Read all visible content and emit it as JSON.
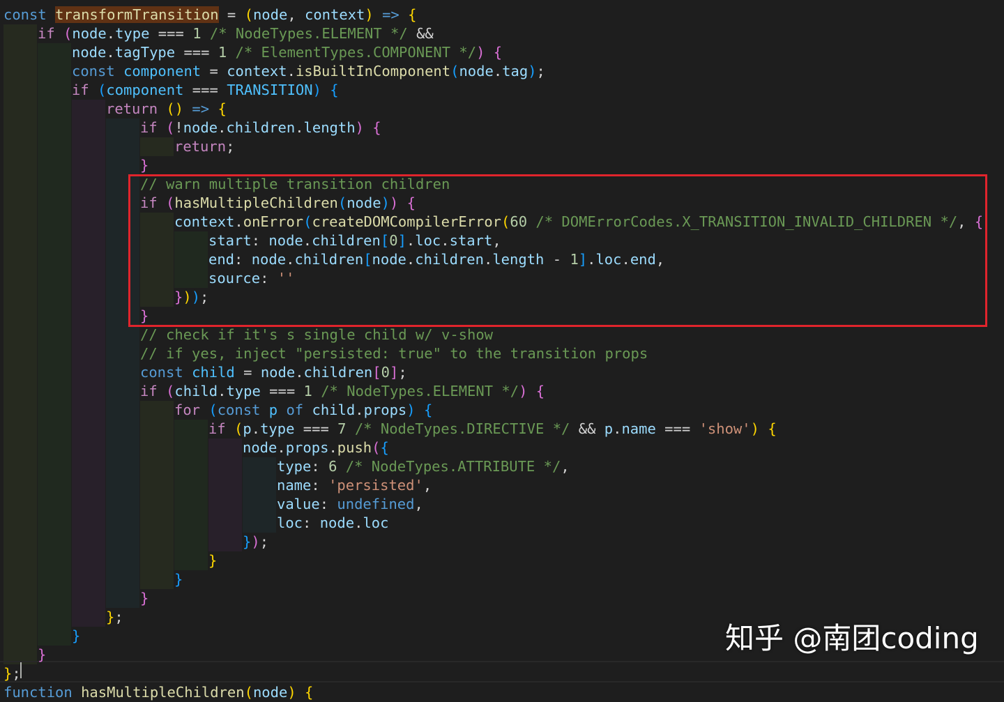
{
  "code_lines": [
    [
      [
        "kw",
        "const "
      ],
      [
        "fnhl",
        "transformTransition"
      ],
      [
        "txt",
        " = "
      ],
      [
        "by",
        "("
      ],
      [
        "var",
        "node"
      ],
      [
        "txt",
        ", "
      ],
      [
        "var",
        "context"
      ],
      [
        "by",
        ")"
      ],
      [
        "kw",
        " => "
      ],
      [
        "by",
        "{"
      ]
    ],
    [
      [
        "kwc",
        "if "
      ],
      [
        "bp",
        "("
      ],
      [
        "var",
        "node"
      ],
      [
        "txt",
        "."
      ],
      [
        "var",
        "type"
      ],
      [
        "txt",
        " === "
      ],
      [
        "num",
        "1"
      ],
      [
        "cmt",
        " /* NodeTypes.ELEMENT */"
      ],
      [
        "txt",
        " &&"
      ]
    ],
    [
      [
        "var",
        "node"
      ],
      [
        "txt",
        "."
      ],
      [
        "var",
        "tagType"
      ],
      [
        "txt",
        " === "
      ],
      [
        "num",
        "1"
      ],
      [
        "cmt",
        " /* ElementTypes.COMPONENT */"
      ],
      [
        "bp",
        ")"
      ],
      [
        "txt",
        " "
      ],
      [
        "bp",
        "{"
      ]
    ],
    [
      [
        "kw",
        "const "
      ],
      [
        "const",
        "component"
      ],
      [
        "txt",
        " = "
      ],
      [
        "var",
        "context"
      ],
      [
        "txt",
        "."
      ],
      [
        "fn",
        "isBuiltInComponent"
      ],
      [
        "bb",
        "("
      ],
      [
        "var",
        "node"
      ],
      [
        "txt",
        "."
      ],
      [
        "var",
        "tag"
      ],
      [
        "bb",
        ")"
      ],
      [
        "txt",
        ";"
      ]
    ],
    [
      [
        "kwc",
        "if "
      ],
      [
        "bb",
        "("
      ],
      [
        "const",
        "component"
      ],
      [
        "txt",
        " === "
      ],
      [
        "const",
        "TRANSITION"
      ],
      [
        "bb",
        ")"
      ],
      [
        "txt",
        " "
      ],
      [
        "bb",
        "{"
      ]
    ],
    [
      [
        "kwc",
        "return "
      ],
      [
        "by",
        "()"
      ],
      [
        "kw",
        " => "
      ],
      [
        "by",
        "{"
      ]
    ],
    [
      [
        "kwc",
        "if "
      ],
      [
        "bp",
        "("
      ],
      [
        "txt",
        "!"
      ],
      [
        "var",
        "node"
      ],
      [
        "txt",
        "."
      ],
      [
        "var",
        "children"
      ],
      [
        "txt",
        "."
      ],
      [
        "var",
        "length"
      ],
      [
        "bp",
        ")"
      ],
      [
        "txt",
        " "
      ],
      [
        "bp",
        "{"
      ]
    ],
    [
      [
        "kwc",
        "return"
      ],
      [
        "txt",
        ";"
      ]
    ],
    [
      [
        "bp",
        "}"
      ]
    ],
    [
      [
        "cmt",
        "// warn multiple transition children"
      ]
    ],
    [
      [
        "kwc",
        "if "
      ],
      [
        "bp",
        "("
      ],
      [
        "fn",
        "hasMultipleChildren"
      ],
      [
        "bb",
        "("
      ],
      [
        "var",
        "node"
      ],
      [
        "bb",
        ")"
      ],
      [
        "bp",
        ")"
      ],
      [
        "txt",
        " "
      ],
      [
        "bp",
        "{"
      ]
    ],
    [
      [
        "var",
        "context"
      ],
      [
        "txt",
        "."
      ],
      [
        "fn",
        "onError"
      ],
      [
        "bb",
        "("
      ],
      [
        "fn",
        "createDOMCompilerError"
      ],
      [
        "by",
        "("
      ],
      [
        "num",
        "60"
      ],
      [
        "cmt",
        " /* DOMErrorCodes.X_TRANSITION_INVALID_CHILDREN */"
      ],
      [
        "txt",
        ", "
      ],
      [
        "bp",
        "{"
      ]
    ],
    [
      [
        "var",
        "start"
      ],
      [
        "txt",
        ": "
      ],
      [
        "var",
        "node"
      ],
      [
        "txt",
        "."
      ],
      [
        "var",
        "children"
      ],
      [
        "bb",
        "["
      ],
      [
        "num",
        "0"
      ],
      [
        "bb",
        "]"
      ],
      [
        "txt",
        "."
      ],
      [
        "var",
        "loc"
      ],
      [
        "txt",
        "."
      ],
      [
        "var",
        "start"
      ],
      [
        "txt",
        ","
      ]
    ],
    [
      [
        "var",
        "end"
      ],
      [
        "txt",
        ": "
      ],
      [
        "var",
        "node"
      ],
      [
        "txt",
        "."
      ],
      [
        "var",
        "children"
      ],
      [
        "bb",
        "["
      ],
      [
        "var",
        "node"
      ],
      [
        "txt",
        "."
      ],
      [
        "var",
        "children"
      ],
      [
        "txt",
        "."
      ],
      [
        "var",
        "length"
      ],
      [
        "txt",
        " - "
      ],
      [
        "num",
        "1"
      ],
      [
        "bb",
        "]"
      ],
      [
        "txt",
        "."
      ],
      [
        "var",
        "loc"
      ],
      [
        "txt",
        "."
      ],
      [
        "var",
        "end"
      ],
      [
        "txt",
        ","
      ]
    ],
    [
      [
        "var",
        "source"
      ],
      [
        "txt",
        ": "
      ],
      [
        "str",
        "''"
      ]
    ],
    [
      [
        "bp",
        "}"
      ],
      [
        "by",
        ")"
      ],
      [
        "bb",
        ")"
      ],
      [
        "txt",
        ";"
      ]
    ],
    [
      [
        "bp",
        "}"
      ]
    ],
    [
      [
        "cmt",
        "// check if it's s single child w/ v-show"
      ]
    ],
    [
      [
        "cmt",
        "// if yes, inject \"persisted: true\" to the transition props"
      ]
    ],
    [
      [
        "kw",
        "const "
      ],
      [
        "const",
        "child"
      ],
      [
        "txt",
        " = "
      ],
      [
        "var",
        "node"
      ],
      [
        "txt",
        "."
      ],
      [
        "var",
        "children"
      ],
      [
        "bp",
        "["
      ],
      [
        "num",
        "0"
      ],
      [
        "bp",
        "]"
      ],
      [
        "txt",
        ";"
      ]
    ],
    [
      [
        "kwc",
        "if "
      ],
      [
        "bp",
        "("
      ],
      [
        "var",
        "child"
      ],
      [
        "txt",
        "."
      ],
      [
        "var",
        "type"
      ],
      [
        "txt",
        " === "
      ],
      [
        "num",
        "1"
      ],
      [
        "cmt",
        " /* NodeTypes.ELEMENT */"
      ],
      [
        "bp",
        ")"
      ],
      [
        "txt",
        " "
      ],
      [
        "bp",
        "{"
      ]
    ],
    [
      [
        "kwc",
        "for "
      ],
      [
        "bb",
        "("
      ],
      [
        "kw",
        "const "
      ],
      [
        "const",
        "p"
      ],
      [
        "kw",
        " of "
      ],
      [
        "var",
        "child"
      ],
      [
        "txt",
        "."
      ],
      [
        "var",
        "props"
      ],
      [
        "bb",
        ")"
      ],
      [
        "txt",
        " "
      ],
      [
        "bb",
        "{"
      ]
    ],
    [
      [
        "kwc",
        "if "
      ],
      [
        "by",
        "("
      ],
      [
        "var",
        "p"
      ],
      [
        "txt",
        "."
      ],
      [
        "var",
        "type"
      ],
      [
        "txt",
        " === "
      ],
      [
        "num",
        "7"
      ],
      [
        "cmt",
        " /* NodeTypes.DIRECTIVE */"
      ],
      [
        "txt",
        " && "
      ],
      [
        "var",
        "p"
      ],
      [
        "txt",
        "."
      ],
      [
        "var",
        "name"
      ],
      [
        "txt",
        " === "
      ],
      [
        "str",
        "'show'"
      ],
      [
        "by",
        ")"
      ],
      [
        "txt",
        " "
      ],
      [
        "by",
        "{"
      ]
    ],
    [
      [
        "var",
        "node"
      ],
      [
        "txt",
        "."
      ],
      [
        "var",
        "props"
      ],
      [
        "txt",
        "."
      ],
      [
        "fn",
        "push"
      ],
      [
        "bp",
        "("
      ],
      [
        "bb",
        "{"
      ]
    ],
    [
      [
        "var",
        "type"
      ],
      [
        "txt",
        ": "
      ],
      [
        "num",
        "6"
      ],
      [
        "cmt",
        " /* NodeTypes.ATTRIBUTE */"
      ],
      [
        "txt",
        ","
      ]
    ],
    [
      [
        "var",
        "name"
      ],
      [
        "txt",
        ": "
      ],
      [
        "str",
        "'persisted'"
      ],
      [
        "txt",
        ","
      ]
    ],
    [
      [
        "var",
        "value"
      ],
      [
        "txt",
        ": "
      ],
      [
        "kw",
        "undefined"
      ],
      [
        "txt",
        ","
      ]
    ],
    [
      [
        "var",
        "loc"
      ],
      [
        "txt",
        ": "
      ],
      [
        "var",
        "node"
      ],
      [
        "txt",
        "."
      ],
      [
        "var",
        "loc"
      ]
    ],
    [
      [
        "bb",
        "}"
      ],
      [
        "bp",
        ")"
      ],
      [
        "txt",
        ";"
      ]
    ],
    [
      [
        "by",
        "}"
      ]
    ],
    [
      [
        "bb",
        "}"
      ]
    ],
    [
      [
        "bp",
        "}"
      ]
    ],
    [
      [
        "by",
        "}"
      ],
      [
        "txt",
        ";"
      ]
    ],
    [
      [
        "bb",
        "}"
      ]
    ],
    [
      [
        "bp",
        "}"
      ]
    ],
    [
      [
        "by",
        "}"
      ],
      [
        "txt",
        ";"
      ]
    ],
    [
      [
        "kw",
        "function "
      ],
      [
        "fn",
        "hasMultipleChildren"
      ],
      [
        "by",
        "("
      ],
      [
        "var",
        "node"
      ],
      [
        "by",
        ")"
      ],
      [
        "txt",
        " "
      ],
      [
        "by",
        "{"
      ]
    ]
  ],
  "watermark": "知乎 @南团coding",
  "colors": {
    "background": "#1e1e1e",
    "highlight_box": "#e0242c",
    "keyword": "#569cd6",
    "control_keyword": "#c586c0",
    "variable": "#9cdcfe",
    "function": "#dcdcaa",
    "comment": "#6a9955",
    "string": "#ce9178",
    "number": "#b5cea8",
    "constant": "#4fc1ff"
  }
}
